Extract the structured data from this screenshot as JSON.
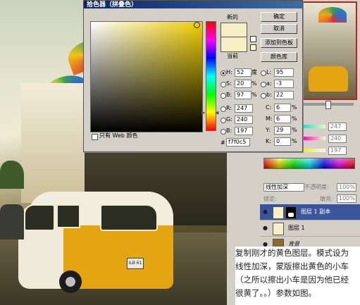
{
  "picker": {
    "title": "拾色器（拼叠色）",
    "new_label": "新的",
    "current_label": "当前",
    "new_color": "#f7f0c5",
    "current_color": "#f7f0c5",
    "buttons": {
      "ok": "确定",
      "cancel": "取消",
      "add_swatch": "添加到色板",
      "color_library": "颜色库"
    },
    "web_only_label": "只有 Web 颜色",
    "hex_prefix": "#",
    "hex_value": "f7f0c5",
    "hsb": [
      {
        "key": "H:",
        "value": "52",
        "unit": "度",
        "selected": true
      },
      {
        "key": "S:",
        "value": "20",
        "unit": "%"
      },
      {
        "key": "B:",
        "value": "97",
        "unit": "%"
      }
    ],
    "rgb": [
      {
        "key": "R:",
        "value": "247"
      },
      {
        "key": "G:",
        "value": "240"
      },
      {
        "key": "B:",
        "value": "197"
      }
    ],
    "lab": [
      {
        "key": "L:",
        "value": "95"
      },
      {
        "key": "a:",
        "value": "-3"
      },
      {
        "key": "b:",
        "value": "22"
      }
    ],
    "cmyk": [
      {
        "key": "C:",
        "value": "6",
        "unit": "%"
      },
      {
        "key": "M:",
        "value": "6",
        "unit": "%"
      },
      {
        "key": "Y:",
        "value": "29",
        "unit": "%"
      },
      {
        "key": "K:",
        "value": "0",
        "unit": "%"
      }
    ]
  },
  "color_panel": {
    "values": [
      "247",
      "240",
      "197"
    ]
  },
  "layers": {
    "blend_mode": "线性加深",
    "opacity_label": "不透明度:",
    "opacity_value": "100%",
    "lock_label": "锁定:",
    "fill_label": "填充:",
    "fill_value": "100%",
    "items": [
      {
        "name": "图层 1 副本",
        "selected": true,
        "thumb": "#f7f0c5"
      },
      {
        "name": "图层 1",
        "selected": false,
        "thumb": "#f7f0c5"
      },
      {
        "name": "背景",
        "selected": false,
        "thumb": "#8a6a30"
      }
    ]
  },
  "caption": {
    "lines": [
      "复制刚才的黄色图层。模式设为",
      "线性加深，蒙版擦出黄色的小车",
      "（之所以擦出小车是因为他已经",
      "很黄了。。）参数如图。"
    ]
  },
  "photo": {
    "license_plate": "ILB 61"
  }
}
